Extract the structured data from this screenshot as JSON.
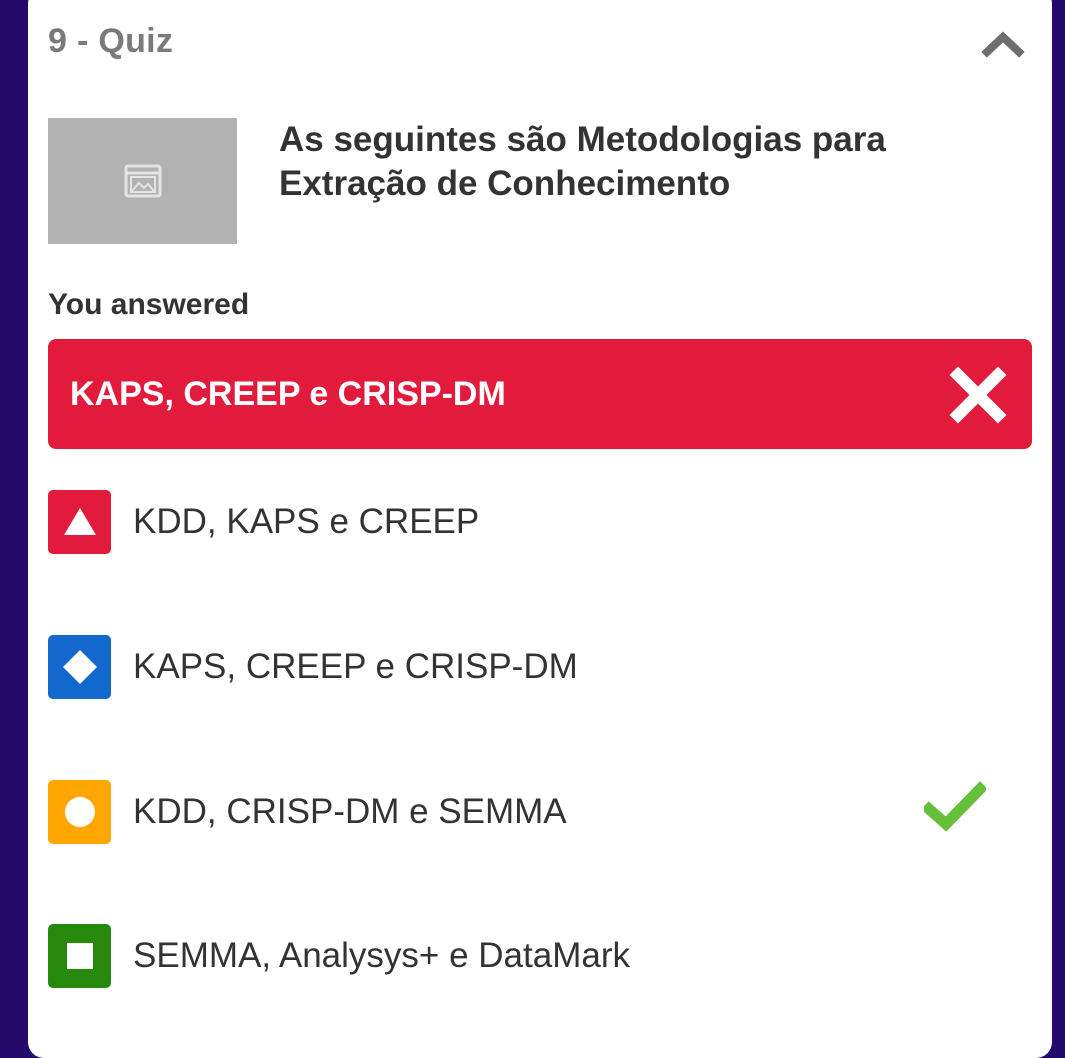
{
  "quiz": {
    "title": "9 - Quiz",
    "question": "As seguintes são Metodologias para Extração de Conhecimento",
    "you_answered_label": "You answered",
    "given_answer": "KAPS, CREEP e CRISP-DM",
    "given_answer_correct": false,
    "options": [
      {
        "shape": "triangle-icon",
        "color": "#e21b3c",
        "label": "KDD, KAPS e CREEP",
        "correct": false
      },
      {
        "shape": "diamond-icon",
        "color": "#1368ce",
        "label": "KAPS, CREEP e CRISP-DM",
        "correct": false
      },
      {
        "shape": "circle-icon",
        "color": "#ffa602",
        "label": "KDD, CRISP-DM e SEMMA",
        "correct": true
      },
      {
        "shape": "square-icon",
        "color": "#26890c",
        "label": "SEMMA, Analysys+ e DataMark",
        "correct": false
      }
    ]
  },
  "colors": {
    "background": "#240a6b",
    "wrong": "#e21b3c",
    "correct_check": "#66bf39"
  }
}
